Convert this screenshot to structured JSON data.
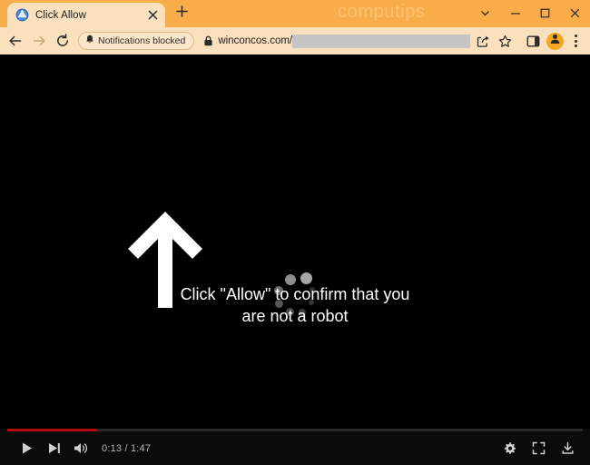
{
  "browser": {
    "watermark": "computips",
    "tab": {
      "title": "Click Allow",
      "favicon_icon": "globe-favicon",
      "close_icon": "close-icon"
    },
    "new_tab_icon": "plus-icon",
    "window_controls": [
      {
        "name": "tab-search-button",
        "icon": "chevron-down-icon",
        "label": ""
      },
      {
        "name": "minimize-button",
        "icon": "minimize-icon",
        "label": ""
      },
      {
        "name": "maximize-button",
        "icon": "maximize-icon",
        "label": ""
      },
      {
        "name": "close-window-button",
        "icon": "close-icon",
        "label": ""
      }
    ],
    "toolbar": {
      "back_icon": "back-arrow-icon",
      "forward_icon": "forward-arrow-icon",
      "reload_icon": "reload-icon",
      "notifications_chip": "Notifications blocked",
      "notifications_chip_icon": "bell-slash-icon",
      "lock_icon": "lock-icon",
      "url": "winconcos.com/",
      "url_redacted": "",
      "share_icon": "share-icon",
      "bookmark_icon": "star-icon",
      "side_panel_icon": "side-panel-icon",
      "avatar_icon": "profile-avatar-icon",
      "menu_icon": "three-dot-menu-icon"
    },
    "theme": {
      "titlebar": "#f9ad4a",
      "toolbar": "#fae0bd",
      "tab_active": "#fae0bd",
      "accent": "#f5a623",
      "watermark_color": "#fec071"
    }
  },
  "page_content": {
    "background": "#000000",
    "arrow_icon": "up-arrow-icon",
    "spinner_icon": "loading-spinner-icon",
    "message_line_1": "Click \"Allow\" to confirm that you",
    "message_line_2": "are not a robot",
    "text_color": "#ffffff"
  },
  "video_controls": {
    "progress_percent": 15.6,
    "progress_color": "#b00b0b",
    "track_color": "#2a2a2a",
    "play_icon": "play-icon",
    "next_icon": "next-track-icon",
    "volume_icon": "volume-on-icon",
    "time": "0:13 / 1:47",
    "current_time": "0:13",
    "duration": "1:47",
    "settings_icon": "gear-icon",
    "fullscreen_icon": "fullscreen-icon",
    "download_icon": "download-icon",
    "bar_color": "#0b0b0b"
  }
}
